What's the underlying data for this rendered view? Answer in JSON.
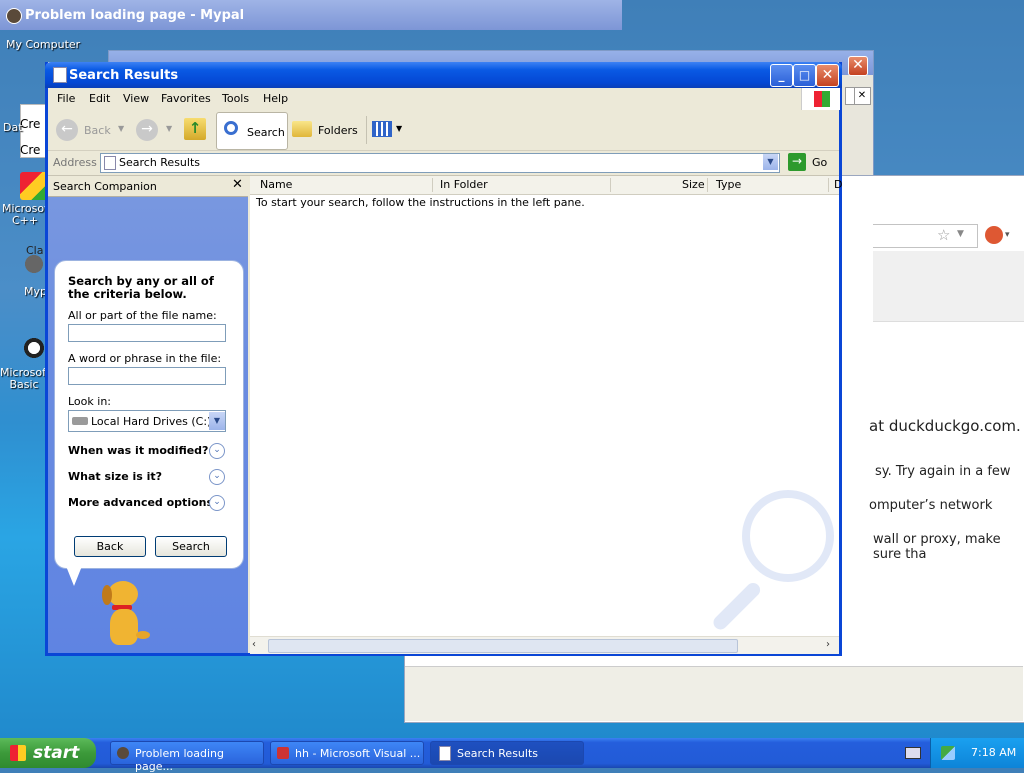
{
  "desktop": {
    "icons": [
      {
        "label": "My Computer"
      },
      {
        "label": "Dat"
      },
      {
        "label": "Microsoft C++"
      },
      {
        "label": "Myp"
      },
      {
        "label": "Microsoft Basic"
      }
    ],
    "partial_text": {
      "cre1": "Cre",
      "cre2": "Cre",
      "cla": "Cla"
    }
  },
  "background_browser": {
    "title": "Problem loading page - Mypal",
    "body_lines": [
      "at duckduckgo.com.",
      "sy. Try again in a few",
      "omputer’s network",
      "wall or proxy, make sure tha"
    ]
  },
  "window": {
    "title": "Search Results",
    "menu": [
      "File",
      "Edit",
      "View",
      "Favorites",
      "Tools",
      "Help"
    ],
    "toolbar": {
      "back": "Back",
      "search": "Search",
      "folders": "Folders"
    },
    "address": {
      "label": "Address",
      "value": "Search Results",
      "go": "Go"
    },
    "companion": {
      "header": "Search Companion",
      "prompt": "Search by any or all of the criteria below.",
      "filename_label": "All or part of the file name:",
      "filename_value": "",
      "phrase_label": "A word or phrase in the file:",
      "phrase_value": "",
      "lookin_label": "Look in:",
      "lookin_value": "Local Hard Drives (C:)",
      "options": [
        "When was it modified?",
        "What size is it?",
        "More advanced options"
      ],
      "back_btn": "Back",
      "search_btn": "Search"
    },
    "results": {
      "columns": [
        "Name",
        "In Folder",
        "Size",
        "Type",
        "D"
      ],
      "message": "To start your search, follow the instructions in the left pane."
    }
  },
  "taskbar": {
    "start": "start",
    "tasks": [
      "Problem loading page...",
      "hh - Microsoft Visual ...",
      "Search Results"
    ],
    "time": "7:18 AM"
  },
  "colors": {
    "xp_blue": "#0a46d6",
    "companion_blue": "#6b8ce0",
    "taskbar": "#245edc",
    "start_green": "#3c9a3a"
  }
}
